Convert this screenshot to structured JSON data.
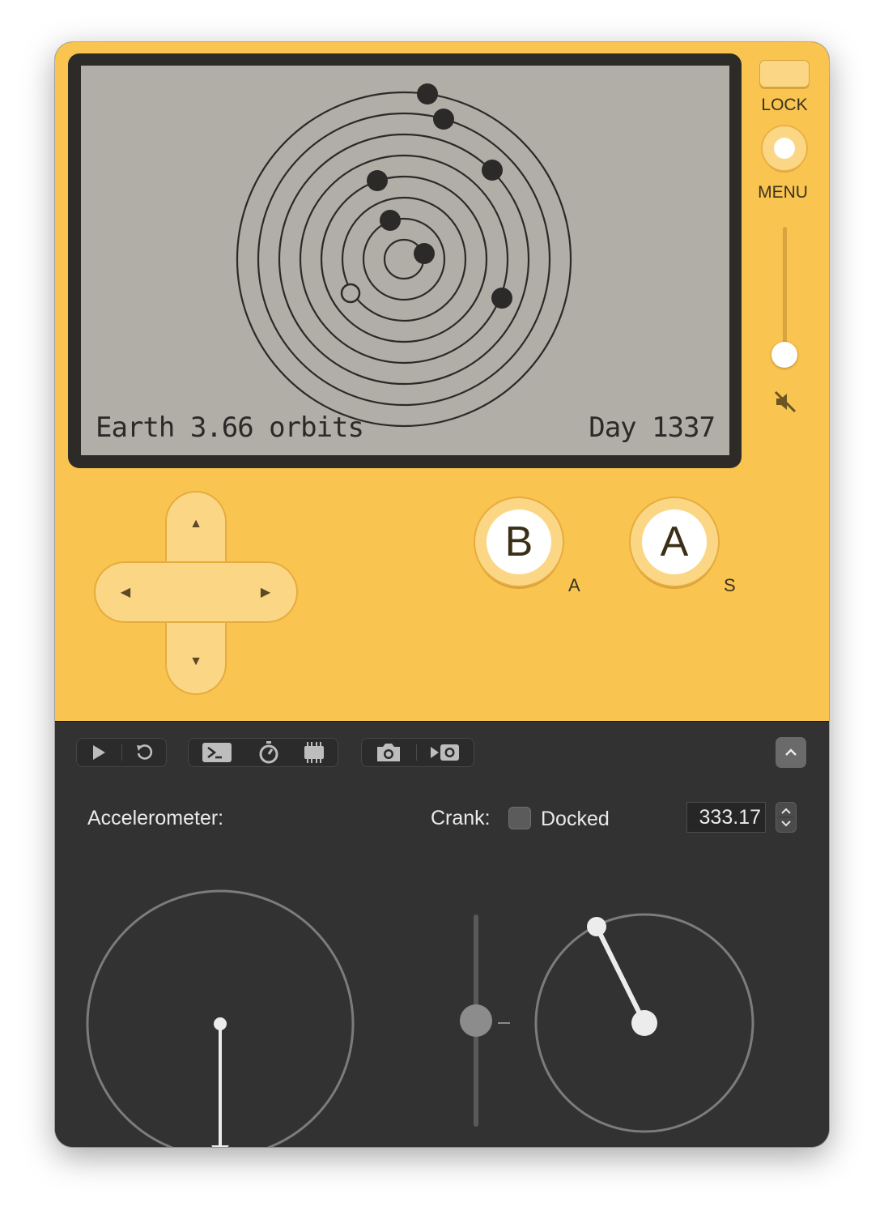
{
  "device": {
    "screen": {
      "left_text": "Earth 3.66 orbits",
      "right_text": "Day 1337"
    },
    "lock_label": "LOCK",
    "menu_label": "MENU",
    "volume_level": 0.1,
    "buttons": {
      "b": {
        "label": "B",
        "key": "A"
      },
      "a": {
        "label": "A",
        "key": "S"
      }
    },
    "dpad": {
      "up": "▲",
      "down": "▼",
      "left": "◀",
      "right": "▶"
    }
  },
  "toolbar": {
    "icons": [
      "play-icon",
      "restart-icon",
      "console-icon",
      "stopwatch-icon",
      "chip-icon",
      "camera-icon",
      "record-video-icon",
      "chevron-up-icon"
    ]
  },
  "controls": {
    "accelerometer_label": "Accelerometer:",
    "crank_label": "Crank:",
    "docked_label": "Docked",
    "docked": false,
    "crank_angle": "333.17"
  },
  "colors": {
    "device": "#f9c44f",
    "button": "#fbd785",
    "panel": "#323232",
    "lcd": "#b1aea7",
    "lcd_ink": "#2b2a28"
  }
}
